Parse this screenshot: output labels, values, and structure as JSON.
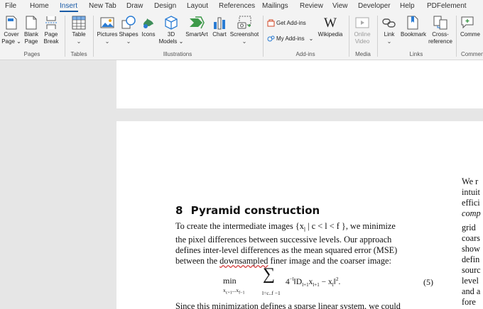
{
  "ribbon": {
    "tabs": [
      "File",
      "Home",
      "Insert",
      "New Tab",
      "Draw",
      "Design",
      "Layout",
      "References",
      "Mailings",
      "Review",
      "View",
      "Developer",
      "Help",
      "PDFelement"
    ],
    "active_tab": "Insert",
    "pages": {
      "cover": [
        "Cover",
        "Page ⌄"
      ],
      "blank": [
        "Blank",
        "Page"
      ],
      "break": [
        "Page",
        "Break"
      ],
      "label": "Pages"
    },
    "tables": {
      "table": "Table",
      "label": "Tables"
    },
    "illustrations": {
      "pictures": "Pictures",
      "shapes": "Shapes",
      "icons": "Icons",
      "models": [
        "3D",
        "Models ⌄"
      ],
      "smartart": "SmartArt",
      "chart": "Chart",
      "screenshot": "Screenshot",
      "label": "Illustrations"
    },
    "addins": {
      "get": "Get Add-ins",
      "my": "My Add-ins",
      "wikipedia": "Wikipedia",
      "label": "Add-ins"
    },
    "media": {
      "online_video": [
        "Online",
        "Video"
      ],
      "label": "Media"
    },
    "links": {
      "link": "Link",
      "bookmark": "Bookmark",
      "cross": [
        "Cross-",
        "reference"
      ],
      "label": "Links"
    },
    "comments": {
      "comment": "Comme",
      "label": "Commen"
    }
  },
  "document": {
    "section_number": "8",
    "section_title": "Pyramid construction",
    "paragraph_1": [
      "To create the intermediate images {x",
      "l",
      " | c < l < f }, we minimize",
      "the pixel differences between successive levels.  Our approach",
      "defines inter-level differences as the mean squared error (MSE)",
      "between the ",
      "downsampled",
      " finer image and the coarser image:"
    ],
    "equation": {
      "min": "min",
      "min_sub": "x",
      "min_sub_detail": "c+1",
      "min_sub_mid": "...x",
      "min_sub_end": "f−1",
      "sum": "∑",
      "sum_sub": "l=c..f −1",
      "expr": "4",
      "expr_exp": "−l",
      "expr_rest": "‖D",
      "expr_D_sub": "l+1",
      "expr_x": "x",
      "expr_x_sub": "l+1",
      "expr_minus": " − x",
      "expr_xl_sub": "l",
      "expr_norm": "‖",
      "expr_norm_exp": "2",
      "expr_end": ".",
      "number": "(5)"
    },
    "paragraph_2": "Since this minimization defines a sparse linear system, we could",
    "right_column": [
      "We r",
      "intuit",
      "effici",
      "comp",
      "grid",
      "coars",
      "show",
      "defin",
      "sourc",
      "level",
      "and a",
      "fore"
    ]
  }
}
